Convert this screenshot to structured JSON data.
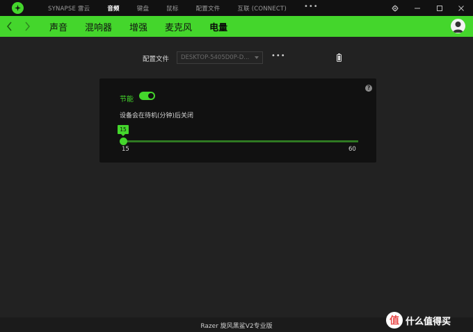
{
  "app": {
    "nav": [
      "SYNAPSE 雷云",
      "音频",
      "键盘",
      "鼠标",
      "配置文件",
      "互联 (CONNECT)"
    ],
    "nav_more": "•••"
  },
  "subnav": {
    "tabs": [
      "声音",
      "混响器",
      "增强",
      "麦克风",
      "电量"
    ],
    "active": "电量"
  },
  "profile": {
    "label": "配置文件",
    "value": "DESKTOP-5405D0P-D...",
    "more": "•••"
  },
  "power": {
    "label": "节能",
    "toggle_on": true,
    "idle_label": "设备会在待机(分钟)后关闭",
    "help": "?",
    "slider": {
      "value": 15,
      "min": 15,
      "max": 60,
      "value_text": "15",
      "min_text": "15",
      "max_text": "60"
    }
  },
  "footer": {
    "device": "Razer 旋风黑鲨V2专业版"
  },
  "watermark": {
    "text": "什么值得买",
    "icon": "值"
  },
  "colors": {
    "accent": "#44d62c",
    "background": "#222222",
    "panel": "#111111"
  }
}
